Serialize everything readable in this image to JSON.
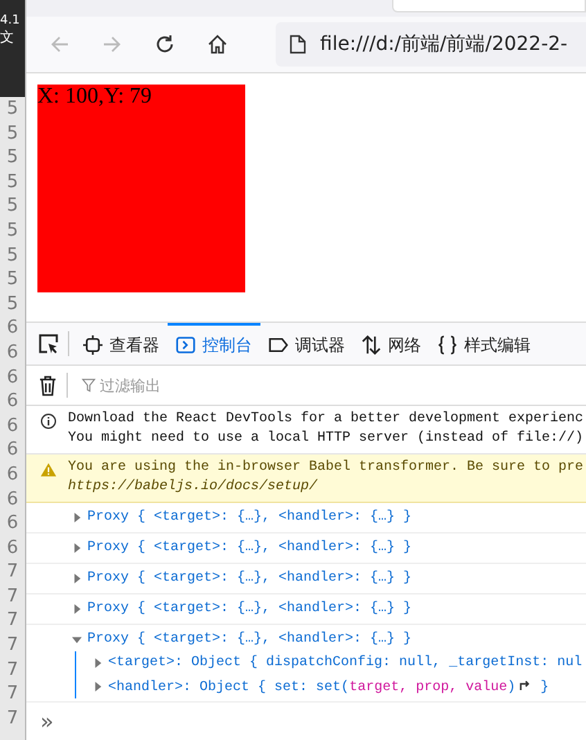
{
  "background_window": {
    "title": "4.1",
    "menu": "文",
    "line_numbers": [
      "5",
      "5",
      "5",
      "5",
      "5",
      "5",
      "5",
      "5",
      "5",
      "6",
      "6",
      "6",
      "6",
      "6",
      "6",
      "6",
      "6",
      "6",
      "6",
      "7",
      "7",
      "7",
      "7",
      "7",
      "7",
      "7"
    ]
  },
  "toolbar": {
    "address": "file:///d:/前端/前端/2022-2-"
  },
  "page": {
    "box_text": "X: 100,Y: 79"
  },
  "devtools": {
    "tabs": [
      {
        "label": "查看器",
        "selected": false
      },
      {
        "label": "控制台",
        "selected": true
      },
      {
        "label": "调试器",
        "selected": false
      },
      {
        "label": "网络",
        "selected": false
      },
      {
        "label": "样式编辑",
        "selected": false
      }
    ],
    "filter": {
      "placeholder": "过滤输出"
    },
    "messages": [
      {
        "kind": "info",
        "lines": [
          "Download the React DevTools for a better development experienc",
          "You might need to use a local HTTP server (instead of file://)"
        ]
      },
      {
        "kind": "warning",
        "lines": [
          "You are using the in-browser Babel transformer. Be sure to pre",
          "https://babeljs.io/docs/setup/"
        ]
      },
      {
        "kind": "object",
        "expanded": false,
        "text": "Proxy { <target>: {…}, <handler>: {…} }"
      },
      {
        "kind": "object",
        "expanded": false,
        "text": "Proxy { <target>: {…}, <handler>: {…} }"
      },
      {
        "kind": "object",
        "expanded": false,
        "text": "Proxy { <target>: {…}, <handler>: {…} }"
      },
      {
        "kind": "object",
        "expanded": false,
        "text": "Proxy { <target>: {…}, <handler>: {…} }"
      },
      {
        "kind": "object",
        "expanded": true,
        "text": "Proxy { <target>: {…}, <handler>: {…} }",
        "children": [
          {
            "expanded": false,
            "parts": [
              {
                "kind": "key",
                "text": "<target>"
              },
              {
                "kind": "plain",
                "text": ": Object { "
              },
              {
                "kind": "key",
                "text": "dispatchConfig"
              },
              {
                "kind": "plain",
                "text": ": null, "
              },
              {
                "kind": "key",
                "text": "_targetInst"
              },
              {
                "kind": "plain",
                "text": ": nul"
              }
            ]
          },
          {
            "expanded": false,
            "parts": [
              {
                "kind": "key",
                "text": "<handler>"
              },
              {
                "kind": "plain",
                "text": ": Object { "
              },
              {
                "kind": "key",
                "text": "set"
              },
              {
                "kind": "plain",
                "text": ": set("
              },
              {
                "kind": "param",
                "text": "target, prop, value"
              },
              {
                "kind": "plain",
                "text": ")"
              },
              {
                "kind": "jump"
              },
              {
                "kind": "plain",
                "text": " }"
              }
            ]
          }
        ]
      }
    ],
    "prompt": "»"
  }
}
